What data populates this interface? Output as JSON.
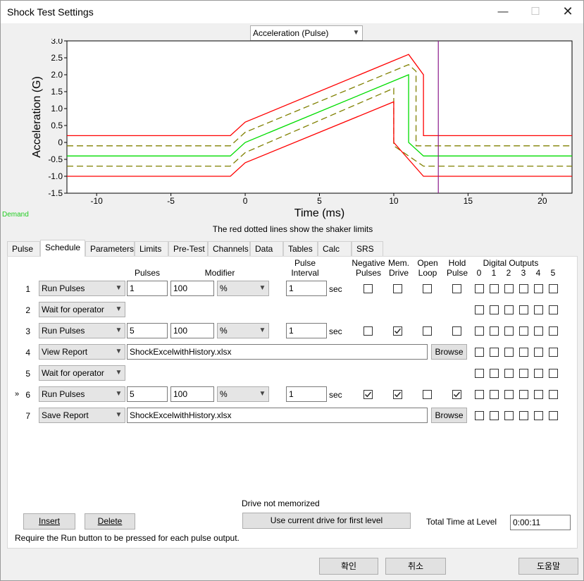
{
  "window": {
    "title": "Shock Test Settings"
  },
  "titlebar": {
    "minimize": "—",
    "maximize": "☐",
    "close": "✕"
  },
  "plot_selector": {
    "value": "Acceleration (Pulse)"
  },
  "chart_data": {
    "type": "line",
    "xlabel": "Time (ms)",
    "ylabel": "Acceleration (G)",
    "xlim": [
      -12,
      22
    ],
    "ylim": [
      -1.5,
      3.0
    ],
    "xticks": [
      -10,
      -5,
      0,
      5,
      10,
      15,
      20
    ],
    "yticks": [
      3.0,
      2.5,
      2.0,
      1.5,
      1.0,
      0.5,
      0,
      -0.5,
      -1.0,
      -1.5
    ],
    "grid": false,
    "marker_x": 13,
    "series": [
      {
        "color": "#ff0000",
        "style": "solid",
        "x": [
          -12,
          -1,
          0,
          11,
          12,
          12,
          22
        ],
        "y": [
          0.2,
          0.2,
          0.6,
          2.6,
          2.0,
          0.2,
          0.2
        ]
      },
      {
        "color": "#808000",
        "style": "dashed",
        "x": [
          -12,
          -1,
          0,
          11,
          11.5,
          11.5,
          22
        ],
        "y": [
          -0.1,
          -0.1,
          0.3,
          2.3,
          2.1,
          -0.1,
          -0.1
        ]
      },
      {
        "color": "#00dd00",
        "style": "solid",
        "x": [
          -12,
          -1,
          0,
          11,
          11,
          12,
          22
        ],
        "y": [
          -0.4,
          -0.4,
          0.0,
          2.0,
          0.0,
          -0.4,
          -0.4
        ]
      },
      {
        "color": "#808000",
        "style": "dashed",
        "x": [
          -12,
          -1,
          0,
          10,
          10,
          12,
          22
        ],
        "y": [
          -0.7,
          -0.7,
          -0.3,
          1.6,
          -0.1,
          -0.7,
          -0.7
        ]
      },
      {
        "color": "#ff0000",
        "style": "solid",
        "x": [
          -12,
          -1,
          0,
          10,
          10,
          12,
          22
        ],
        "y": [
          -1.0,
          -1.0,
          -0.6,
          1.2,
          0.0,
          -1.0,
          -1.0
        ]
      }
    ]
  },
  "legend": {
    "demand": "Demand"
  },
  "note": {
    "shaker_limits": "The red dotted lines show the shaker limits"
  },
  "tabs": [
    "Pulse",
    "Schedule",
    "Parameters",
    "Limits",
    "Pre-Test",
    "Channels",
    "Data",
    "Tables",
    "Calc",
    "SRS"
  ],
  "schedule": {
    "headers": {
      "pulses": "Pulses",
      "modifier": "Modifier",
      "pulse_interval": "Pulse Interval",
      "negative_pulses": "Negative Pulses",
      "mem_drive": "Mem. Drive",
      "open_loop": "Open Loop",
      "hold_pulse": "Hold Pulse",
      "digital_outputs": "Digital Outputs",
      "do_numbers": [
        "0",
        "1",
        "2",
        "3",
        "4",
        "5"
      ]
    },
    "rows": [
      {
        "marker": "",
        "num": "1",
        "action": "Run Pulses",
        "pulses": "1",
        "modifier": "100",
        "mod_unit": "%",
        "interval": "1",
        "interval_unit": "sec",
        "neg": false,
        "mem": false,
        "open": false,
        "hold": false
      },
      {
        "marker": "",
        "num": "2",
        "action": "Wait for operator"
      },
      {
        "marker": "",
        "num": "3",
        "action": "Run Pulses",
        "pulses": "5",
        "modifier": "100",
        "mod_unit": "%",
        "interval": "1",
        "interval_unit": "sec",
        "neg": false,
        "mem": true,
        "open": false,
        "hold": false
      },
      {
        "marker": "",
        "num": "4",
        "action": "View Report",
        "file": "ShockExcelwithHistory.xlsx",
        "browse": "Browse"
      },
      {
        "marker": "",
        "num": "5",
        "action": "Wait for operator"
      },
      {
        "marker": "»",
        "num": "6",
        "action": "Run Pulses",
        "pulses": "5",
        "modifier": "100",
        "mod_unit": "%",
        "interval": "1",
        "interval_unit": "sec",
        "neg": true,
        "mem": true,
        "open": false,
        "hold": true
      },
      {
        "marker": "",
        "num": "7",
        "action": "Save Report",
        "file": "ShockExcelwithHistory.xlsx",
        "browse": "Browse"
      }
    ]
  },
  "drive_status": "Drive not memorized",
  "buttons": {
    "insert": "Insert",
    "delete": "Delete",
    "use_drive": "Use current drive for first level"
  },
  "total_time": {
    "label": "Total Time at Level",
    "value": "0:00:11"
  },
  "require_note": "Require the Run button to be pressed for each pulse output.",
  "dialog": {
    "ok": "확인",
    "cancel": "취소",
    "help": "도움말"
  }
}
